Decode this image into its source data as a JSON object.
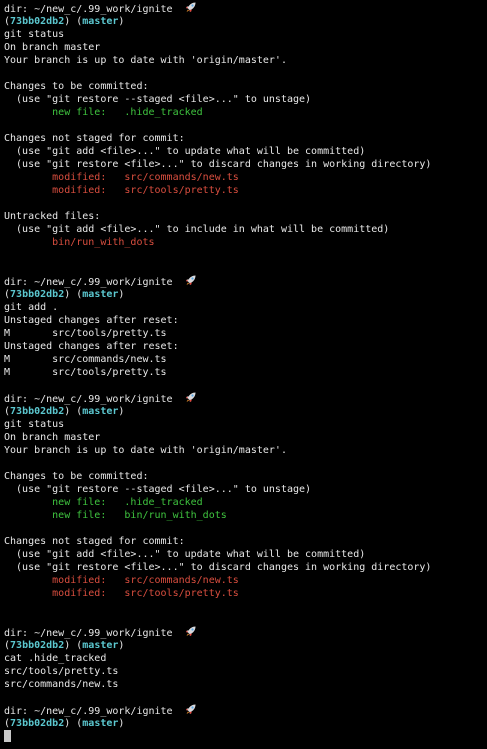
{
  "colors": {
    "default": "#e8e8e8",
    "hash": "#5cc8d0",
    "green": "#3fc43f",
    "red": "#d94e3f",
    "cursor": "#c8c8c8",
    "background": "#000000"
  },
  "lines": [
    {
      "type": "dir",
      "text": "dir: ~/new_c/.99_work/ignite  "
    },
    {
      "type": "branch",
      "hash": "73bb02db2",
      "branch": "master",
      "pre": "(",
      "mid": ") (",
      "post": ")"
    },
    {
      "type": "text",
      "text": "git status"
    },
    {
      "type": "text",
      "text": "On branch master"
    },
    {
      "type": "text",
      "text": "Your branch is up to date with 'origin/master'."
    },
    {
      "type": "blank"
    },
    {
      "type": "text",
      "text": "Changes to be committed:"
    },
    {
      "type": "text",
      "text": "  (use \"git restore --staged <file>...\" to unstage)"
    },
    {
      "type": "green",
      "text": "        new file:   .hide_tracked"
    },
    {
      "type": "blank"
    },
    {
      "type": "text",
      "text": "Changes not staged for commit:"
    },
    {
      "type": "text",
      "text": "  (use \"git add <file>...\" to update what will be committed)"
    },
    {
      "type": "text",
      "text": "  (use \"git restore <file>...\" to discard changes in working directory)"
    },
    {
      "type": "red",
      "text": "        modified:   src/commands/new.ts"
    },
    {
      "type": "red",
      "text": "        modified:   src/tools/pretty.ts"
    },
    {
      "type": "blank"
    },
    {
      "type": "text",
      "text": "Untracked files:"
    },
    {
      "type": "text",
      "text": "  (use \"git add <file>...\" to include in what will be committed)"
    },
    {
      "type": "red",
      "text": "        bin/run_with_dots"
    },
    {
      "type": "blank"
    },
    {
      "type": "blank"
    },
    {
      "type": "dir",
      "text": "dir: ~/new_c/.99_work/ignite  "
    },
    {
      "type": "branch",
      "hash": "73bb02db2",
      "branch": "master",
      "pre": "(",
      "mid": ") (",
      "post": ")"
    },
    {
      "type": "text",
      "text": "git add ."
    },
    {
      "type": "text",
      "text": "Unstaged changes after reset:"
    },
    {
      "type": "text",
      "text": "M       src/tools/pretty.ts"
    },
    {
      "type": "text",
      "text": "Unstaged changes after reset:"
    },
    {
      "type": "text",
      "text": "M       src/commands/new.ts"
    },
    {
      "type": "text",
      "text": "M       src/tools/pretty.ts"
    },
    {
      "type": "blank"
    },
    {
      "type": "dir",
      "text": "dir: ~/new_c/.99_work/ignite  "
    },
    {
      "type": "branch",
      "hash": "73bb02db2",
      "branch": "master",
      "pre": "(",
      "mid": ") (",
      "post": ")"
    },
    {
      "type": "text",
      "text": "git status"
    },
    {
      "type": "text",
      "text": "On branch master"
    },
    {
      "type": "text",
      "text": "Your branch is up to date with 'origin/master'."
    },
    {
      "type": "blank"
    },
    {
      "type": "text",
      "text": "Changes to be committed:"
    },
    {
      "type": "text",
      "text": "  (use \"git restore --staged <file>...\" to unstage)"
    },
    {
      "type": "green",
      "text": "        new file:   .hide_tracked"
    },
    {
      "type": "green",
      "text": "        new file:   bin/run_with_dots"
    },
    {
      "type": "blank"
    },
    {
      "type": "text",
      "text": "Changes not staged for commit:"
    },
    {
      "type": "text",
      "text": "  (use \"git add <file>...\" to update what will be committed)"
    },
    {
      "type": "text",
      "text": "  (use \"git restore <file>...\" to discard changes in working directory)"
    },
    {
      "type": "red",
      "text": "        modified:   src/commands/new.ts"
    },
    {
      "type": "red",
      "text": "        modified:   src/tools/pretty.ts"
    },
    {
      "type": "blank"
    },
    {
      "type": "blank"
    },
    {
      "type": "dir",
      "text": "dir: ~/new_c/.99_work/ignite  "
    },
    {
      "type": "branch",
      "hash": "73bb02db2",
      "branch": "master",
      "pre": "(",
      "mid": ") (",
      "post": ")"
    },
    {
      "type": "text",
      "text": "cat .hide_tracked"
    },
    {
      "type": "text",
      "text": "src/tools/pretty.ts"
    },
    {
      "type": "text",
      "text": "src/commands/new.ts"
    },
    {
      "type": "blank"
    },
    {
      "type": "dir",
      "text": "dir: ~/new_c/.99_work/ignite  "
    },
    {
      "type": "branch",
      "hash": "73bb02db2",
      "branch": "master",
      "pre": "(",
      "mid": ") (",
      "post": ")"
    },
    {
      "type": "cursor"
    }
  ]
}
